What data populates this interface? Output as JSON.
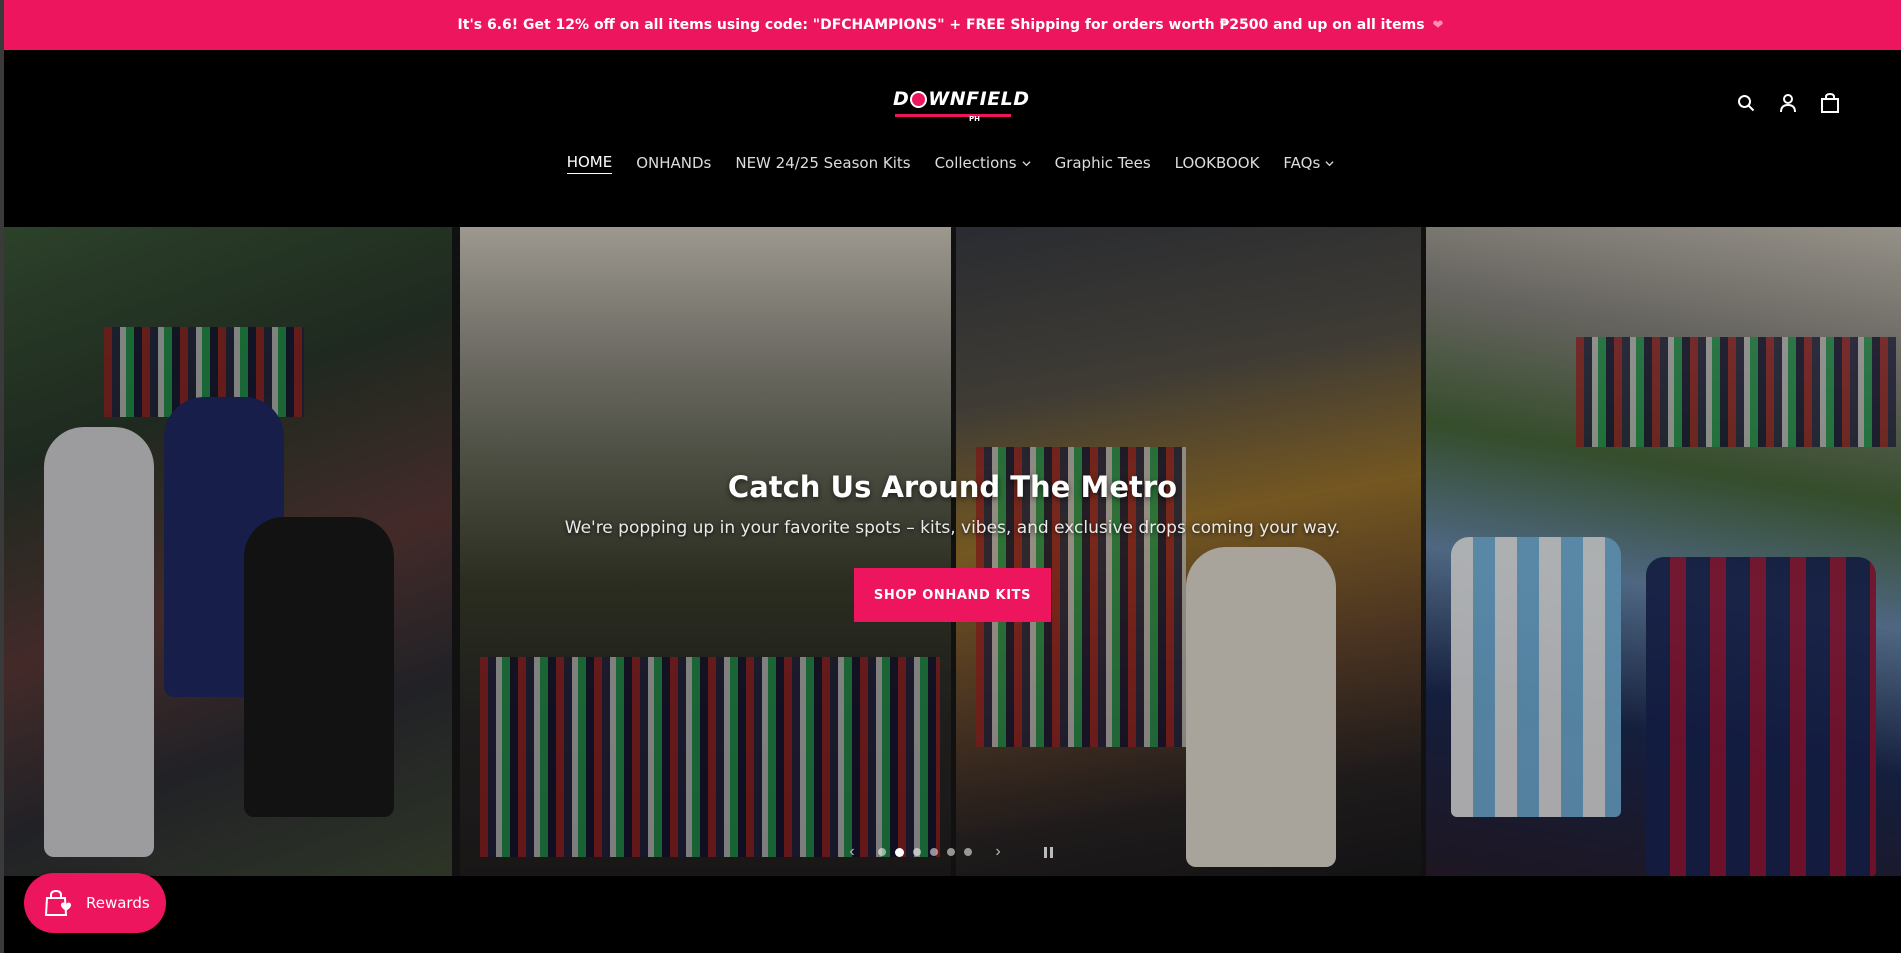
{
  "announcement": {
    "text": "It's 6.6! Get 12% off on all items using code: \"DFCHAMPIONS\" + FREE Shipping for orders worth ₱2500 and up on all items",
    "emoji": "❤"
  },
  "logo": {
    "text_left": "D",
    "text_right": "WNFIELD",
    "tag": "PH"
  },
  "header_icons": [
    "search-icon",
    "account-icon",
    "cart-icon"
  ],
  "nav": {
    "items": [
      {
        "label": "HOME",
        "active": true,
        "dropdown": false
      },
      {
        "label": "ONHANDs",
        "active": false,
        "dropdown": false
      },
      {
        "label": "NEW 24/25 Season Kits",
        "active": false,
        "dropdown": false
      },
      {
        "label": "Collections",
        "active": false,
        "dropdown": true
      },
      {
        "label": "Graphic Tees",
        "active": false,
        "dropdown": false
      },
      {
        "label": "LOOKBOOK",
        "active": false,
        "dropdown": false
      },
      {
        "label": "FAQs",
        "active": false,
        "dropdown": true
      }
    ]
  },
  "hero": {
    "title": "Catch Us Around The Metro",
    "subtitle": "We're popping up in your favorite spots – kits, vibes, and exclusive drops coming your way.",
    "button_label": "SHOP ONHAND KITS",
    "slides_count": 6,
    "active_slide": 2
  },
  "rewards": {
    "label": "Rewards"
  },
  "colors": {
    "accent": "#ee155f",
    "background": "#000000"
  }
}
